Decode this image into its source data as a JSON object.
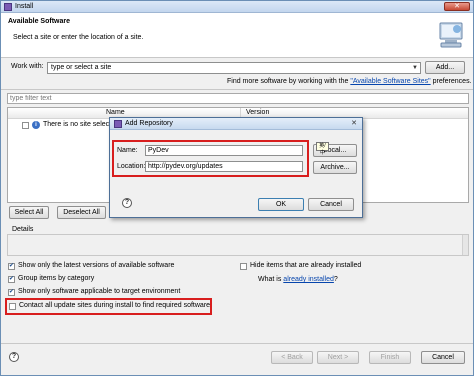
{
  "window": {
    "title": "Install",
    "close_glyph": "✕"
  },
  "banner": {
    "heading": "Available Software",
    "subtitle": "Select a site or enter the location of a site.",
    "icon": "wizard-install-icon"
  },
  "work_with": {
    "label": "Work with:",
    "value": "type or select a site",
    "add_button": "Add...",
    "hint_prefix": "Find more software by working with the ",
    "hint_link": "\"Available Software Sites\"",
    "hint_suffix": " preferences."
  },
  "filter": {
    "placeholder": "type filter text"
  },
  "table": {
    "columns": [
      "Name",
      "Version"
    ],
    "rows": [
      {
        "text": "There is no site selecte",
        "checked": false
      }
    ]
  },
  "selection": {
    "select_all": "Select All",
    "deselect_all": "Deselect All"
  },
  "details": {
    "label": "Details"
  },
  "options": {
    "left": [
      {
        "label": "Show only the latest versions of available software",
        "checked": true
      },
      {
        "label": "Group items by category",
        "checked": true
      },
      {
        "label": "Show only software applicable to target environment",
        "checked": true
      },
      {
        "label": "Contact all update sites during install to find required software",
        "checked": false
      }
    ],
    "hide_installed": {
      "label": "Hide items that are already installed",
      "checked": false
    },
    "what_is_prefix": "What is ",
    "what_is_link": "already installed",
    "what_is_suffix": "?"
  },
  "footer": {
    "back": "< Back",
    "next": "Next >",
    "finish": "Finish",
    "cancel": "Cancel"
  },
  "dialog": {
    "title": "Add Repository",
    "close_glyph": "✕",
    "name_label": "Name:",
    "name_value": "PyDev",
    "location_label": "Location:",
    "location_value": "http://pydev.org/updates",
    "local_button": "Local...",
    "archive_button": "Archive...",
    "ok_button": "OK",
    "cancel_button": "Cancel",
    "tooltip": "英/中"
  },
  "colors": {
    "highlight": "#d81e1e",
    "link": "#0645ad",
    "title_bar": "#c3d6ee"
  }
}
